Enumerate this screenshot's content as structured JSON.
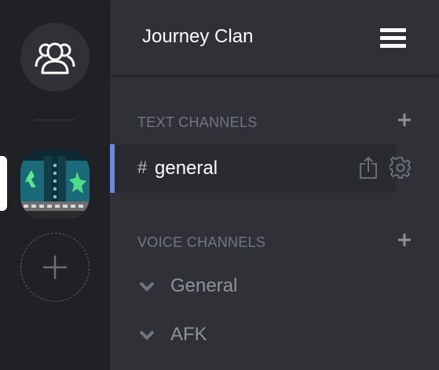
{
  "servers": {
    "friends_icon": "friends-icon",
    "add_server_icon": "plus-icon"
  },
  "guild": {
    "name": "Journey Clan",
    "menu_icon": "hamburger-menu-icon"
  },
  "text_category": {
    "label": "TEXT CHANNELS",
    "add_icon": "plus-icon"
  },
  "text_channels": [
    {
      "prefix": "#",
      "name": "general",
      "selected": true
    }
  ],
  "voice_category": {
    "label": "VOICE CHANNELS",
    "add_icon": "plus-icon"
  },
  "voice_channels": [
    {
      "name": "General"
    },
    {
      "name": "AFK"
    }
  ],
  "colors": {
    "rail_bg": "#1f2124",
    "panel_bg": "#2f3136",
    "selected_bg": "#292b2f",
    "accent": "#7289da",
    "muted_text": "#72767d"
  }
}
